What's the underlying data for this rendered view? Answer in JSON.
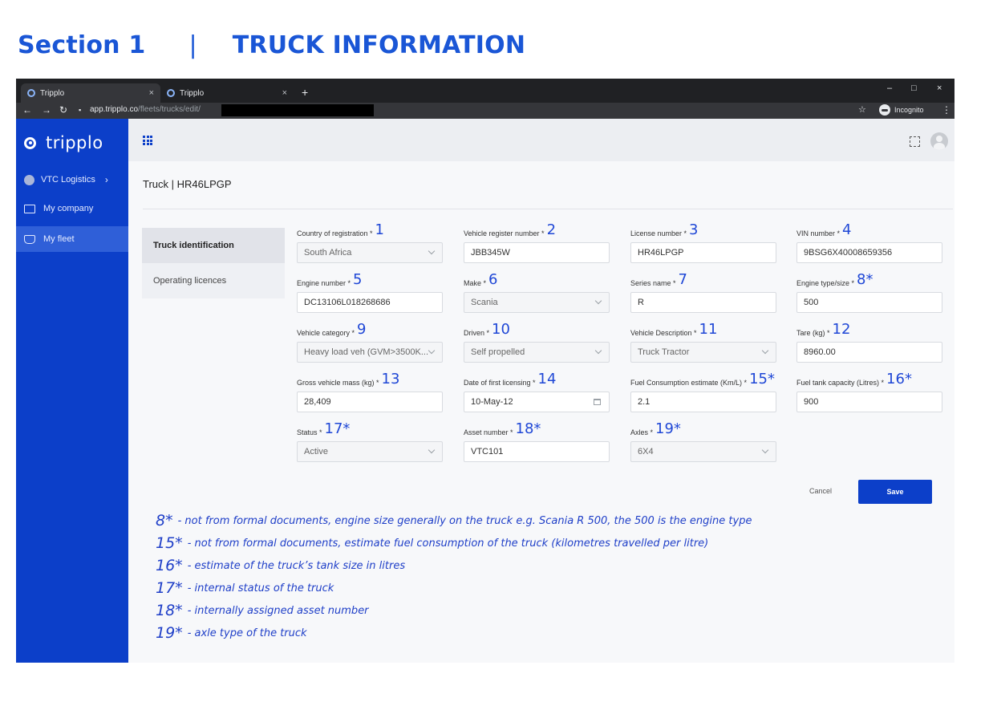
{
  "heading": {
    "section": "Section 1",
    "separator": "|",
    "title": "TRUCK INFORMATION"
  },
  "browser": {
    "tabs": [
      {
        "label": "Tripplo",
        "close": "×"
      },
      {
        "label": "Tripplo",
        "close": "×"
      }
    ],
    "new_tab": "+",
    "window_controls": {
      "minimize": "–",
      "maximize": "□",
      "close": "×"
    },
    "url_host": "app.tripplo.co",
    "url_path": "/fleets/trucks/edit/",
    "incognito_label": "Incognito"
  },
  "sidebar": {
    "brand": "tripplo",
    "org": "VTC Logistics",
    "items": [
      {
        "label": "My company"
      },
      {
        "label": "My fleet"
      }
    ]
  },
  "page": {
    "breadcrumb": "Truck | HR46LPGP",
    "left_nav": [
      {
        "label": "Truck identification"
      },
      {
        "label": "Operating licences"
      }
    ]
  },
  "form": {
    "fields": [
      {
        "label": "Country of registration *",
        "num": "1",
        "value": "South Africa",
        "kind": "select"
      },
      {
        "label": "Vehicle register number *",
        "num": "2",
        "value": "JBB345W",
        "kind": "text"
      },
      {
        "label": "License number *",
        "num": "3",
        "value": "HR46LPGP",
        "kind": "text"
      },
      {
        "label": "VIN number *",
        "num": "4",
        "value": "9BSG6X40008659356",
        "kind": "text"
      },
      {
        "label": "Engine number *",
        "num": "5",
        "value": "DC13106L018268686",
        "kind": "text"
      },
      {
        "label": "Make *",
        "num": "6",
        "value": "Scania",
        "kind": "select"
      },
      {
        "label": "Series name *",
        "num": "7",
        "value": "R",
        "kind": "text"
      },
      {
        "label": "Engine type/size *",
        "num": "8*",
        "value": "500",
        "kind": "text"
      },
      {
        "label": "Vehicle category *",
        "num": "9",
        "value": "Heavy load veh (GVM>3500K...",
        "kind": "select"
      },
      {
        "label": "Driven *",
        "num": "10",
        "value": "Self propelled",
        "kind": "select"
      },
      {
        "label": "Vehicle Description *",
        "num": "11",
        "value": "Truck Tractor",
        "kind": "select"
      },
      {
        "label": "Tare (kg) *",
        "num": "12",
        "value": "8960.00",
        "kind": "text"
      },
      {
        "label": "Gross vehicle mass (kg) *",
        "num": "13",
        "value": "28,409",
        "kind": "text"
      },
      {
        "label": "Date of first licensing *",
        "num": "14",
        "value": "10-May-12",
        "kind": "date"
      },
      {
        "label": "Fuel Consumption estimate (Km/L) *",
        "num": "15*",
        "value": "2.1",
        "kind": "text"
      },
      {
        "label": "Fuel tank capacity (Litres) *",
        "num": "16*",
        "value": "900",
        "kind": "text"
      },
      {
        "label": "Status *",
        "num": "17*",
        "value": "Active",
        "kind": "select"
      },
      {
        "label": "Asset number *",
        "num": "18*",
        "value": "VTC101",
        "kind": "text"
      },
      {
        "label": "Axles *",
        "num": "19*",
        "value": "6X4",
        "kind": "select"
      }
    ],
    "cancel_label": "Cancel",
    "save_label": "Save"
  },
  "notes": [
    {
      "key": "8*",
      "text": "- not from formal documents, engine size generally on the truck e.g. Scania R 500, the 500 is the engine type"
    },
    {
      "key": "15*",
      "text": "- not from formal documents, estimate fuel consumption of the truck (kilometres travelled per litre)"
    },
    {
      "key": "16*",
      "text": "- estimate of the truck’s tank size in litres"
    },
    {
      "key": "17*",
      "text": "- internal status of the truck"
    },
    {
      "key": "18*",
      "text": "- internally assigned asset number"
    },
    {
      "key": "19*",
      "text": "- axle type of the truck"
    }
  ],
  "colors": {
    "brand_blue": "#0c3fc9",
    "heading_blue": "#1a56d6",
    "annotation_blue": "#1f3fc8"
  }
}
